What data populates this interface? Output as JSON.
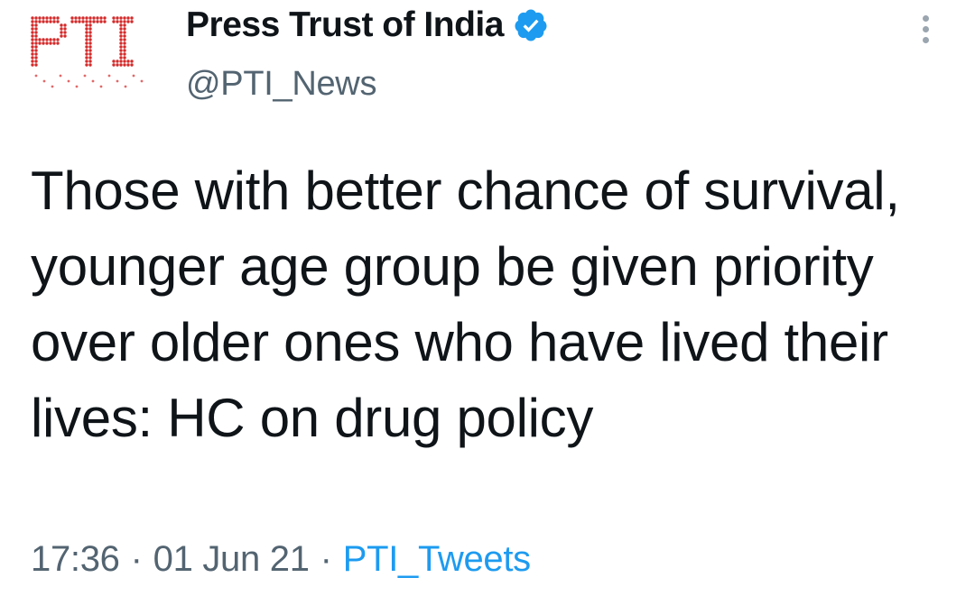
{
  "account": {
    "avatar_icon": "pti-logo-icon",
    "avatar_text": "PTI",
    "display_name": "Press Trust of India",
    "verified_icon": "verified-badge-icon",
    "handle": "@PTI_News"
  },
  "more_menu_icon": "more-vertical-icon",
  "tweet": {
    "text": "Those with better chance of survival, younger age group be given priority over older ones who have lived their lives: HC on drug policy"
  },
  "meta": {
    "time": "17:36",
    "separator": "·",
    "date": "01 Jun 21",
    "source": "PTI_Tweets"
  },
  "colors": {
    "text": "#0f1419",
    "secondary": "#536471",
    "link": "#1d9bf0",
    "verified": "#1d9bf0",
    "logo_red": "#d42a2a"
  }
}
